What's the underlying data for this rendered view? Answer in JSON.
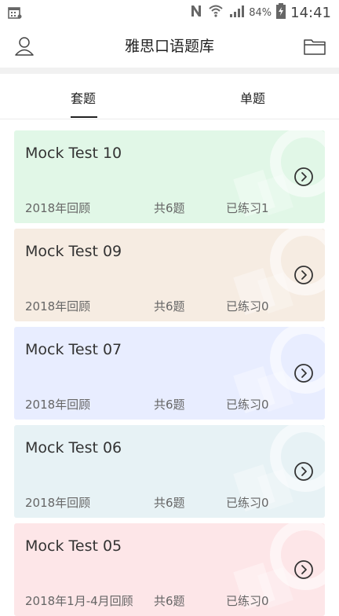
{
  "status_bar": {
    "battery_pct": "84%",
    "time": "14:41"
  },
  "header": {
    "title": "雅思口语题库"
  },
  "tabs": [
    {
      "label": "套题",
      "selected": true
    },
    {
      "label": "单题",
      "selected": false
    }
  ],
  "cards": [
    {
      "title": "Mock Test 10",
      "period": "2018年回顾",
      "count": "共6题",
      "practiced": "已练习1",
      "color": "#e1f7e7"
    },
    {
      "title": "Mock Test 09",
      "period": "2018年回顾",
      "count": "共6题",
      "practiced": "已练习0",
      "color": "#f6ece2"
    },
    {
      "title": "Mock Test 07",
      "period": "2018年回顾",
      "count": "共6题",
      "practiced": "已练习0",
      "color": "#e8edff"
    },
    {
      "title": "Mock Test 06",
      "period": "2018年回顾",
      "count": "共6题",
      "practiced": "已练习0",
      "color": "#e7f2f5"
    },
    {
      "title": "Mock Test 05",
      "period": "2018年1月-4月回顾",
      "count": "共6题",
      "practiced": "已练习0",
      "color": "#fde6e8"
    }
  ]
}
